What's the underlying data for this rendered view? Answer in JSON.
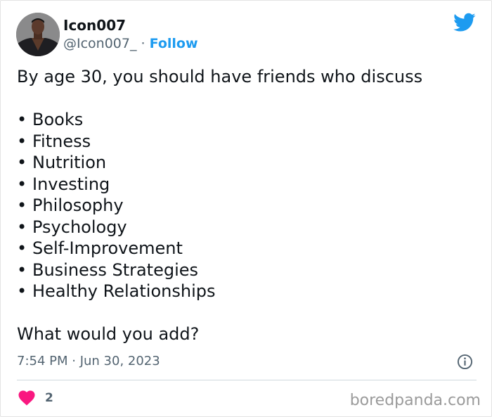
{
  "author": {
    "name": "Icon007",
    "handle": "@Icon007_",
    "separator": "·",
    "follow_label": "Follow"
  },
  "tweet": {
    "intro": "By age 30, you should have friends who discuss",
    "bullet_char": "•",
    "items": [
      "Books",
      "Fitness",
      "Nutrition",
      "Investing",
      "Philosophy",
      "Psychology",
      "Self-Improvement",
      "Business Strategies",
      "Healthy Relationships"
    ],
    "closing": "What would you add?",
    "timestamp": "7:54 PM · Jun 30, 2023"
  },
  "engagement": {
    "like_count": "2"
  },
  "watermark": "boredpanda.com",
  "colors": {
    "accent": "#1d9bf0",
    "like": "#f91880",
    "text": "#0f1419",
    "muted": "#536471"
  },
  "icons": {
    "brand": "twitter-bird-icon",
    "info": "info-icon",
    "like": "heart-icon"
  }
}
